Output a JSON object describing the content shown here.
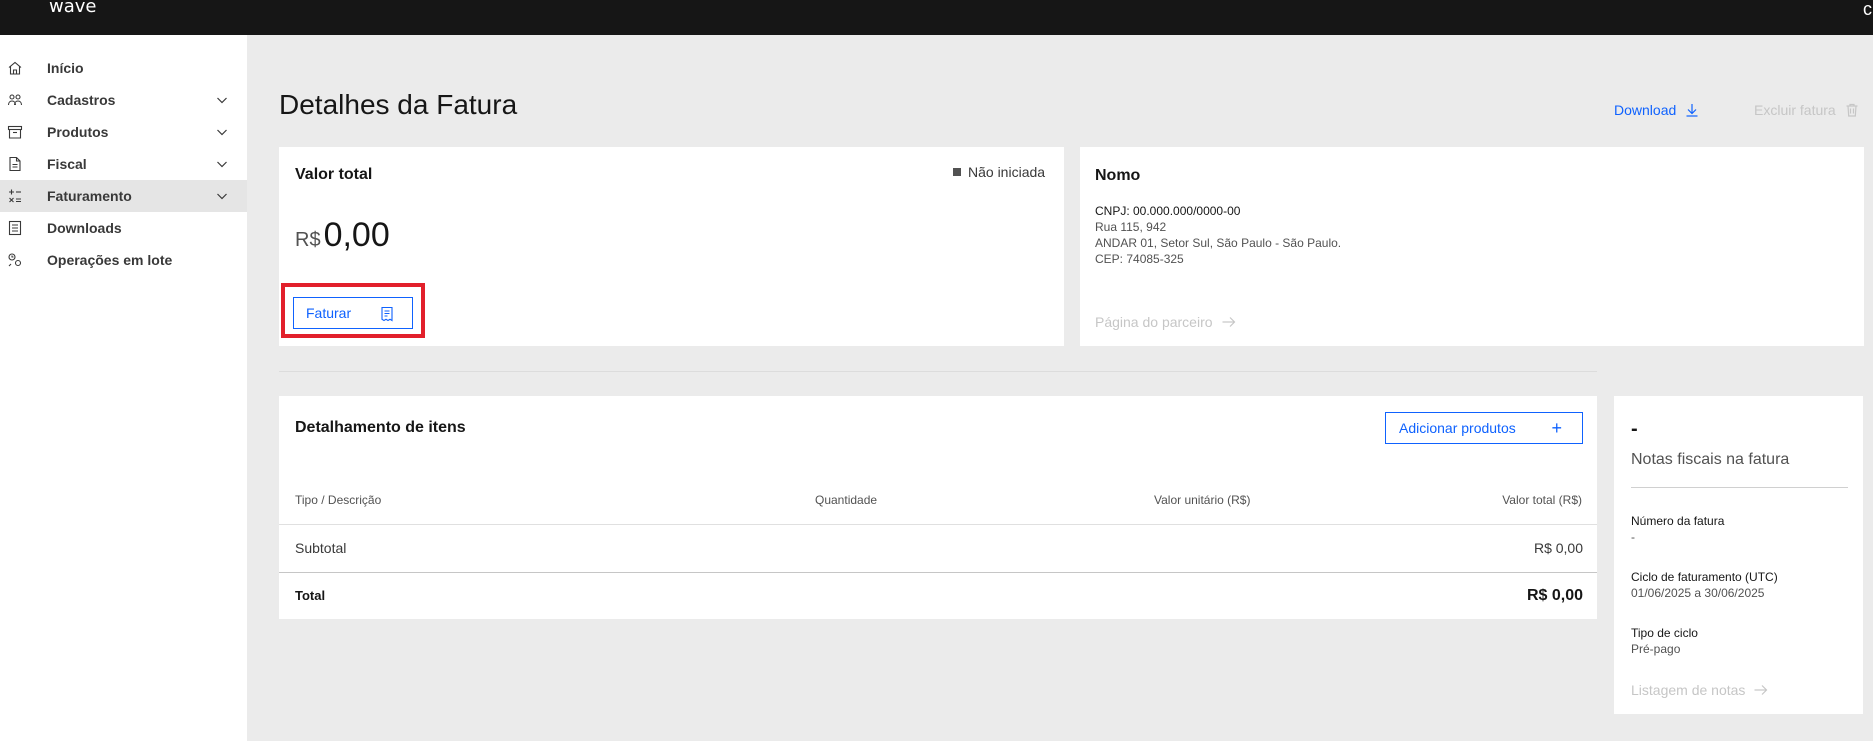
{
  "app": {
    "brand": "wave",
    "top_right_glyph": "c"
  },
  "sidebar": {
    "items": [
      {
        "label": "Início",
        "icon": "home-icon",
        "has_chevron": false,
        "active": false
      },
      {
        "label": "Cadastros",
        "icon": "users-icon",
        "has_chevron": true,
        "active": false
      },
      {
        "label": "Produtos",
        "icon": "archive-icon",
        "has_chevron": true,
        "active": false
      },
      {
        "label": "Fiscal",
        "icon": "document-icon",
        "has_chevron": true,
        "active": false
      },
      {
        "label": "Faturamento",
        "icon": "calculator-icon",
        "has_chevron": true,
        "active": true
      },
      {
        "label": "Downloads",
        "icon": "download-box-icon",
        "has_chevron": false,
        "active": false
      },
      {
        "label": "Operações em lote",
        "icon": "batch-operations-icon",
        "has_chevron": false,
        "active": false
      }
    ]
  },
  "header": {
    "title": "Detalhes da Fatura",
    "download_label": "Download",
    "delete_label": "Excluir fatura"
  },
  "total_card": {
    "title": "Valor total",
    "status": "Não iniciada",
    "currency": "R$",
    "value": "0,00",
    "faturar_label": "Faturar"
  },
  "partner_card": {
    "name": "Nomo",
    "cnpj": "CNPJ: 00.000.000/0000-00",
    "address_line1": "Rua 115, 942",
    "address_line2": "ANDAR 01, Setor Sul, São Paulo - São Paulo.",
    "cep": "CEP: 74085-325",
    "partner_link": "Página do parceiro"
  },
  "items_card": {
    "title": "Detalhamento de itens",
    "add_label": "Adicionar produtos",
    "columns": [
      "Tipo / Descrição",
      "Quantidade",
      "Valor unitário (R$)",
      "Valor total (R$)"
    ],
    "subtotal_label": "Subtotal",
    "subtotal_value": "R$ 0,00",
    "total_label": "Total",
    "total_value": "R$ 0,00"
  },
  "side_card": {
    "dash": "-",
    "subtitle": "Notas fiscais na fatura",
    "invoice_number_label": "Número da fatura",
    "invoice_number_value": "-",
    "cycle_label": "Ciclo de faturamento (UTC)",
    "cycle_value": "01/06/2025 a 30/06/2025",
    "cycle_type_label": "Tipo de ciclo",
    "cycle_type_value": "Pré-pago",
    "notes_link": "Listagem de notas"
  },
  "colors": {
    "accent": "#0f62fe",
    "highlight": "#e2202b",
    "topbar": "#161616",
    "page_bg": "#ebebeb"
  }
}
